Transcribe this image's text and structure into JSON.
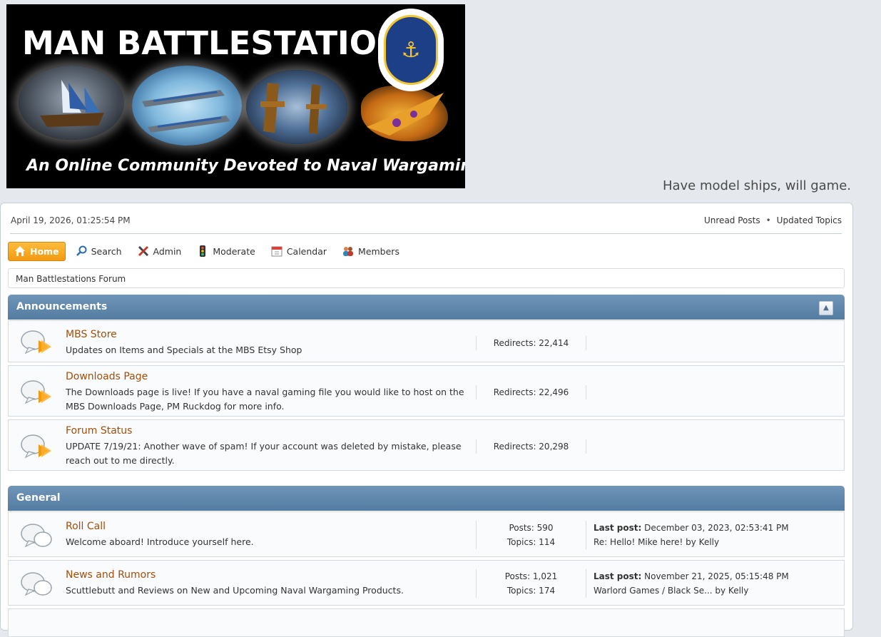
{
  "banner": {
    "title": "MAN BATTLESTATIONS",
    "subtitle": "An Online Community Devoted to Naval Wargaming",
    "emblem_text": "MAN BATTLESTATIONS!"
  },
  "tagline": "Have model ships, will game.",
  "topbar": {
    "datetime": "April 19, 2026, 01:25:54 PM",
    "unread_posts": "Unread Posts",
    "separator": "•",
    "updated_topics": "Updated Topics"
  },
  "nav": [
    {
      "label": "Home",
      "icon": "home-icon"
    },
    {
      "label": "Search",
      "icon": "search-icon"
    },
    {
      "label": "Admin",
      "icon": "admin-tools-icon"
    },
    {
      "label": "Moderate",
      "icon": "traffic-light-icon"
    },
    {
      "label": "Calendar",
      "icon": "calendar-icon"
    },
    {
      "label": "Members",
      "icon": "members-icon"
    }
  ],
  "breadcrumb": "Man Battlestations Forum",
  "categories": [
    {
      "name": "Announcements",
      "boards": [
        {
          "name": "MBS Store",
          "desc": "Updates on Items and Specials at the MBS Etsy Shop",
          "stats": [
            "Redirects: 22,414"
          ]
        },
        {
          "name": "Downloads Page",
          "desc": "The Downloads page is live! If you have a naval gaming file you would like to host on the MBS Downloads Page, PM Ruckdog for more info.",
          "stats": [
            "Redirects: 22,496"
          ]
        },
        {
          "name": "Forum Status",
          "desc": "UPDATE 7/19/21: Another wave of spam! If your account was deleted by mistake, please reach out to me directly.",
          "stats": [
            "Redirects: 20,298"
          ]
        }
      ]
    },
    {
      "name": "General",
      "boards": [
        {
          "name": "Roll Call",
          "desc": "Welcome aboard! Introduce yourself here.",
          "stats": [
            "Posts: 590",
            "Topics: 114"
          ],
          "last_post_label": "Last post:",
          "last_post_date": "December 03, 2023, 02:53:41 PM",
          "last_post_info": "Re: Hello! Mike here! by Kelly"
        },
        {
          "name": "News and Rumors",
          "desc": "Scuttlebutt and Reviews on New and Upcoming Naval Wargaming Products.",
          "stats": [
            "Posts: 1,021",
            "Topics: 174"
          ],
          "last_post_label": "Last post:",
          "last_post_date": "November 21, 2025, 05:15:48 PM",
          "last_post_info": "Warlord Games / Black Se... by Kelly"
        }
      ]
    }
  ],
  "colors": {
    "accent": "#f29a12",
    "category_header": "#5f87ad",
    "board_link": "#a24e0c"
  }
}
